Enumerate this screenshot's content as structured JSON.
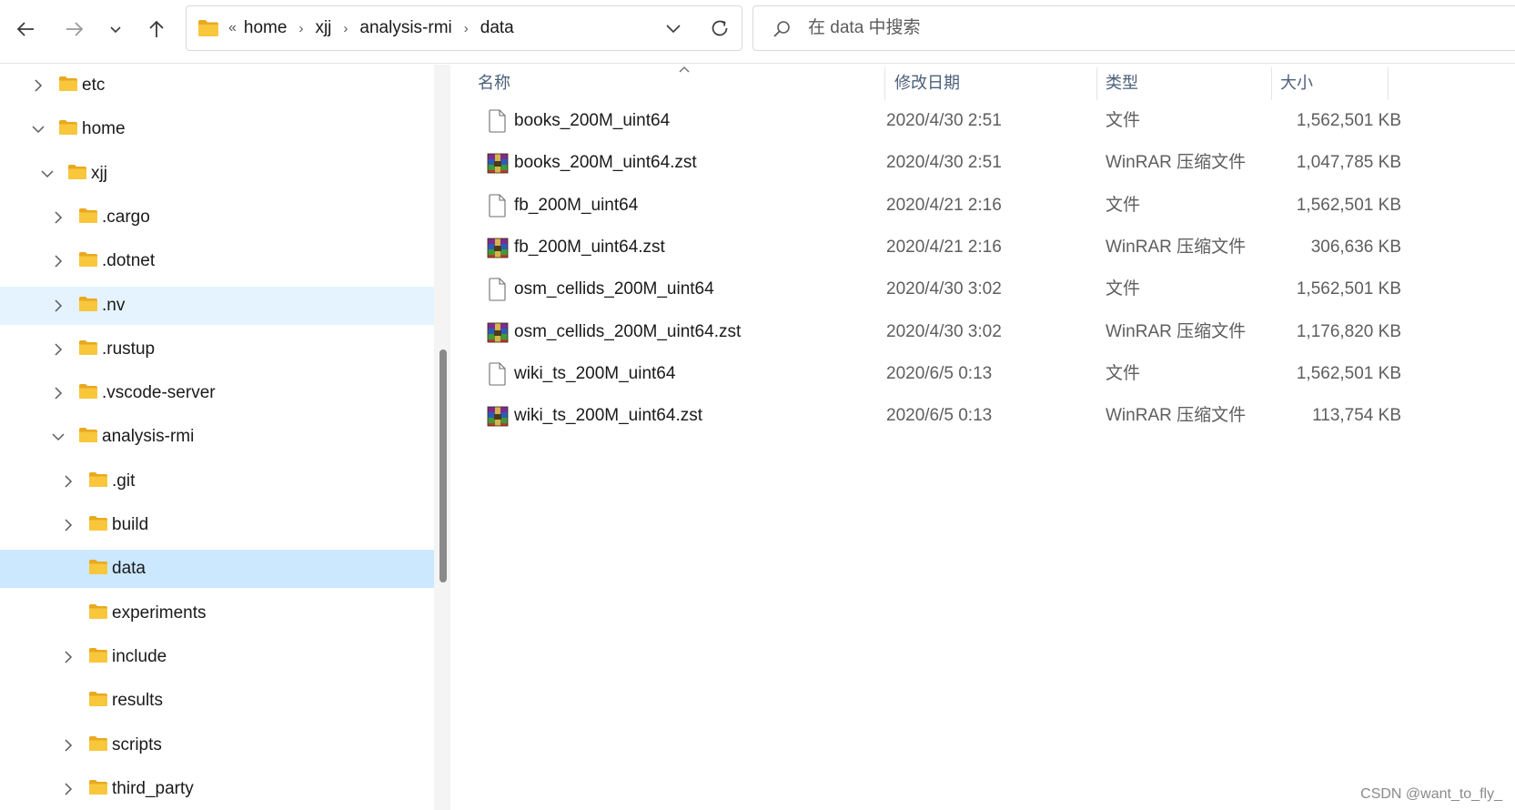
{
  "addressbar": {
    "overflow_glyph": "«",
    "crumbs": [
      "home",
      "xjj",
      "analysis-rmi",
      "data"
    ]
  },
  "search": {
    "placeholder": "在 data 中搜索"
  },
  "tree": [
    {
      "label": "etc",
      "level": 0,
      "chevron": "right",
      "state": ""
    },
    {
      "label": "home",
      "level": 0,
      "chevron": "down",
      "state": ""
    },
    {
      "label": "xjj",
      "level": 1,
      "chevron": "down",
      "state": ""
    },
    {
      "label": ".cargo",
      "level": 2,
      "chevron": "right",
      "state": ""
    },
    {
      "label": ".dotnet",
      "level": 2,
      "chevron": "right",
      "state": ""
    },
    {
      "label": ".nv",
      "level": 2,
      "chevron": "right",
      "state": "hover"
    },
    {
      "label": ".rustup",
      "level": 2,
      "chevron": "right",
      "state": ""
    },
    {
      "label": ".vscode-server",
      "level": 2,
      "chevron": "right",
      "state": ""
    },
    {
      "label": "analysis-rmi",
      "level": 2,
      "chevron": "down",
      "state": ""
    },
    {
      "label": ".git",
      "level": 3,
      "chevron": "right",
      "state": ""
    },
    {
      "label": "build",
      "level": 3,
      "chevron": "right",
      "state": ""
    },
    {
      "label": "data",
      "level": 3,
      "chevron": "none",
      "state": "selected"
    },
    {
      "label": "experiments",
      "level": 3,
      "chevron": "none",
      "state": ""
    },
    {
      "label": "include",
      "level": 3,
      "chevron": "right",
      "state": ""
    },
    {
      "label": "results",
      "level": 3,
      "chevron": "none",
      "state": ""
    },
    {
      "label": "scripts",
      "level": 3,
      "chevron": "right",
      "state": ""
    },
    {
      "label": "third_party",
      "level": 3,
      "chevron": "right",
      "state": ""
    }
  ],
  "columns": {
    "name": "名称",
    "date": "修改日期",
    "type": "类型",
    "size": "大小"
  },
  "files": [
    {
      "name": "books_200M_uint64",
      "date": "2020/4/30 2:51",
      "type": "文件",
      "size": "1,562,501 KB",
      "icon": "file-icon"
    },
    {
      "name": "books_200M_uint64.zst",
      "date": "2020/4/30 2:51",
      "type": "WinRAR 压缩文件",
      "size": "1,047,785 KB",
      "icon": "winrar-icon"
    },
    {
      "name": "fb_200M_uint64",
      "date": "2020/4/21 2:16",
      "type": "文件",
      "size": "1,562,501 KB",
      "icon": "file-icon"
    },
    {
      "name": "fb_200M_uint64.zst",
      "date": "2020/4/21 2:16",
      "type": "WinRAR 压缩文件",
      "size": "306,636 KB",
      "icon": "winrar-icon"
    },
    {
      "name": "osm_cellids_200M_uint64",
      "date": "2020/4/30 3:02",
      "type": "文件",
      "size": "1,562,501 KB",
      "icon": "file-icon"
    },
    {
      "name": "osm_cellids_200M_uint64.zst",
      "date": "2020/4/30 3:02",
      "type": "WinRAR 压缩文件",
      "size": "1,176,820 KB",
      "icon": "winrar-icon"
    },
    {
      "name": "wiki_ts_200M_uint64",
      "date": "2020/6/5 0:13",
      "type": "文件",
      "size": "1,562,501 KB",
      "icon": "file-icon"
    },
    {
      "name": "wiki_ts_200M_uint64.zst",
      "date": "2020/6/5 0:13",
      "type": "WinRAR 压缩文件",
      "size": "113,754 KB",
      "icon": "winrar-icon"
    }
  ],
  "watermark": "CSDN @want_to_fly_",
  "colors": {
    "selected": "#cce8ff",
    "hover": "#e5f3ff",
    "folder": "#f8c73b",
    "header_text": "#4c607a"
  }
}
